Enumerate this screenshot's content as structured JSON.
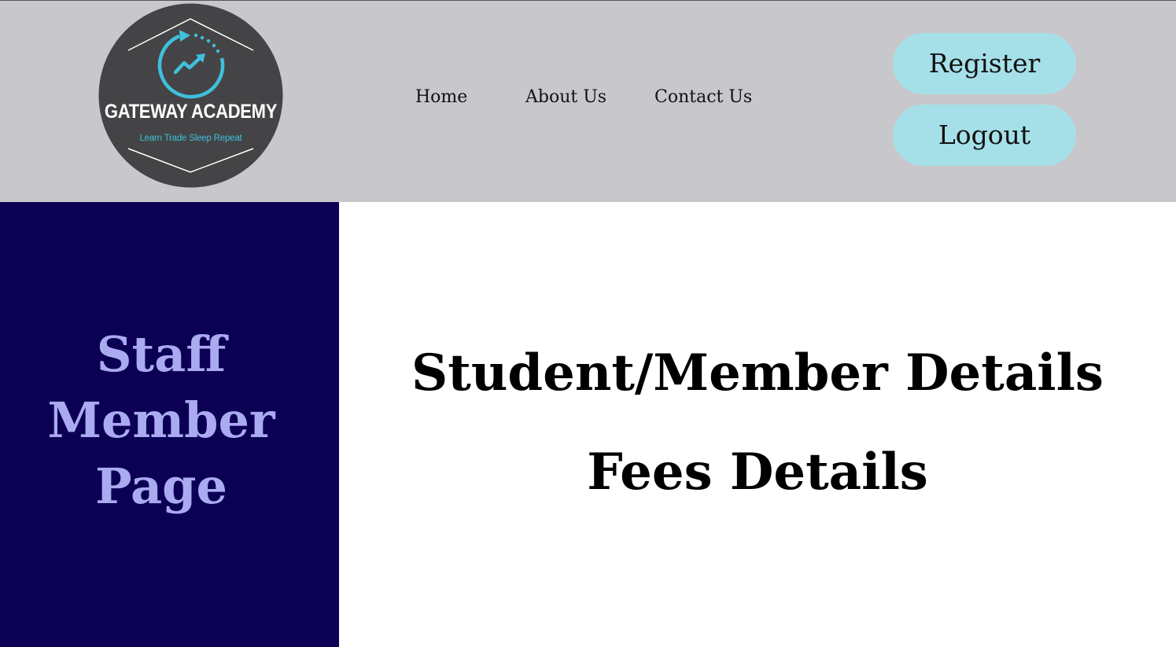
{
  "header": {
    "logo": {
      "brand_text": "GATEWAY ACADEMY",
      "tagline": "Learn Trade Sleep Repeat",
      "icon": "trending-up-cycle-icon",
      "colors": {
        "circle": "#444446",
        "accent": "#3fc0dc",
        "text": "#ffffff"
      }
    },
    "nav": {
      "home": "Home",
      "about": "About Us",
      "contact": "Contact Us"
    },
    "actions": {
      "register": "Register",
      "logout": "Logout"
    },
    "colors": {
      "background": "#c8c7cc",
      "button": "#a5e0e8"
    }
  },
  "sidebar": {
    "title": "Staff\nMember\nPage",
    "colors": {
      "background": "#0c0055",
      "text": "#aaaaf0"
    }
  },
  "main": {
    "links": {
      "student_details": "Student/Member Details",
      "fees_details": "Fees Details"
    }
  }
}
